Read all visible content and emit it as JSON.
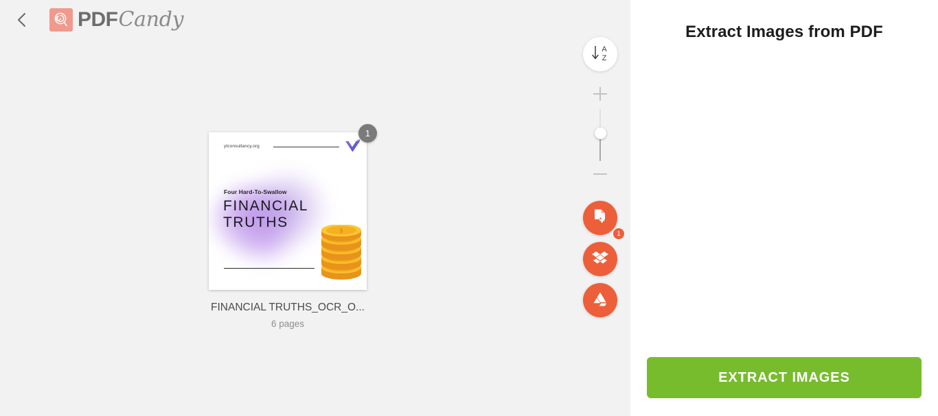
{
  "header": {
    "back_icon": "chevron-left-icon",
    "brand": {
      "mark_icon": "lollipop-icon",
      "word_bold": "PDF",
      "word_script": "Candy"
    }
  },
  "canvas": {
    "file": {
      "name": "FINANCIAL TRUTHS_OCR_O...",
      "pages": "6 pages",
      "page_badge": "1",
      "thumbnail": {
        "site": "ytconsultancy.org",
        "kicker": "Four Hard-To-Swallow",
        "title": "FINANCIAL\nTRUTHS",
        "logo_icon": "v-checkmark-icon",
        "coins_icon": "coin-stack-icon"
      }
    }
  },
  "tools": {
    "sort": {
      "icon": "sort-az-icon",
      "letter_top": "A",
      "letter_bottom": "Z"
    },
    "zoom": {
      "in_icon": "plus-icon",
      "out_icon": "minus-icon",
      "handle_icon": "slider-handle"
    },
    "add_file": {
      "icon": "document-plus-icon",
      "badge": "1"
    },
    "dropbox": {
      "icon": "dropbox-icon"
    },
    "google_drive": {
      "icon": "google-drive-icon"
    }
  },
  "panel": {
    "title": "Extract Images from PDF",
    "action_label": "EXTRACT IMAGES"
  },
  "colors": {
    "brand_salmon": "#ef9a8d",
    "accent_orange": "#ec5f3a",
    "action_green": "#77bc2d",
    "canvas_gray": "#f2f2f2",
    "badge_gray": "#7a7a7a"
  }
}
